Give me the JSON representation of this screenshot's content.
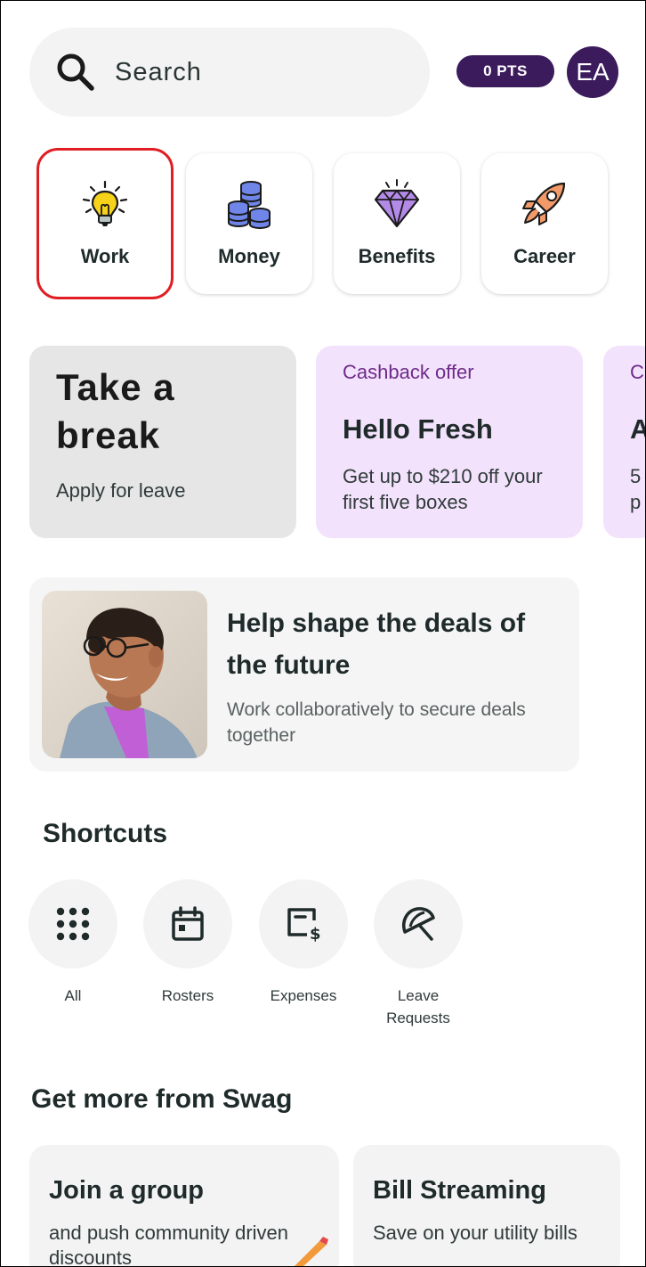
{
  "header": {
    "search_placeholder": "Search",
    "points_label": "0 PTS",
    "avatar_initials": "EA"
  },
  "categories": [
    {
      "label": "Work",
      "icon": "lightbulb-icon",
      "selected": true
    },
    {
      "label": "Money",
      "icon": "coins-icon",
      "selected": false
    },
    {
      "label": "Benefits",
      "icon": "diamond-icon",
      "selected": false
    },
    {
      "label": "Career",
      "icon": "rocket-icon",
      "selected": false
    }
  ],
  "promos": {
    "leave": {
      "title": "Take a break",
      "subtitle": "Apply for leave"
    },
    "hellofresh": {
      "eyebrow": "Cashback offer",
      "title": "Hello Fresh",
      "description": "Get up to $210 off your first five boxes"
    },
    "partial": {
      "eyebrow": "C",
      "title": "A",
      "line1": "5",
      "line2": "p"
    }
  },
  "feature": {
    "title": "Help shape the deals of the future",
    "description": "Work collaboratively to secure deals together"
  },
  "shortcuts": {
    "title": "Shortcuts",
    "items": [
      {
        "label": "All",
        "icon": "grid-icon"
      },
      {
        "label": "Rosters",
        "icon": "calendar-icon"
      },
      {
        "label": "Expenses",
        "icon": "expense-icon"
      },
      {
        "label": "Leave Requests",
        "icon": "umbrella-icon"
      }
    ]
  },
  "more": {
    "title": "Get more from Swag",
    "cards": [
      {
        "title": "Join a group",
        "description": "and push community driven discounts"
      },
      {
        "title": "Bill Streaming",
        "description": "Save on your utility bills"
      }
    ]
  },
  "colors": {
    "brand_purple": "#3c1b5c",
    "selection_outline": "#e01e24",
    "promo_pink": "#f3e2fb",
    "eyebrow_purple": "#6e2a8a"
  }
}
